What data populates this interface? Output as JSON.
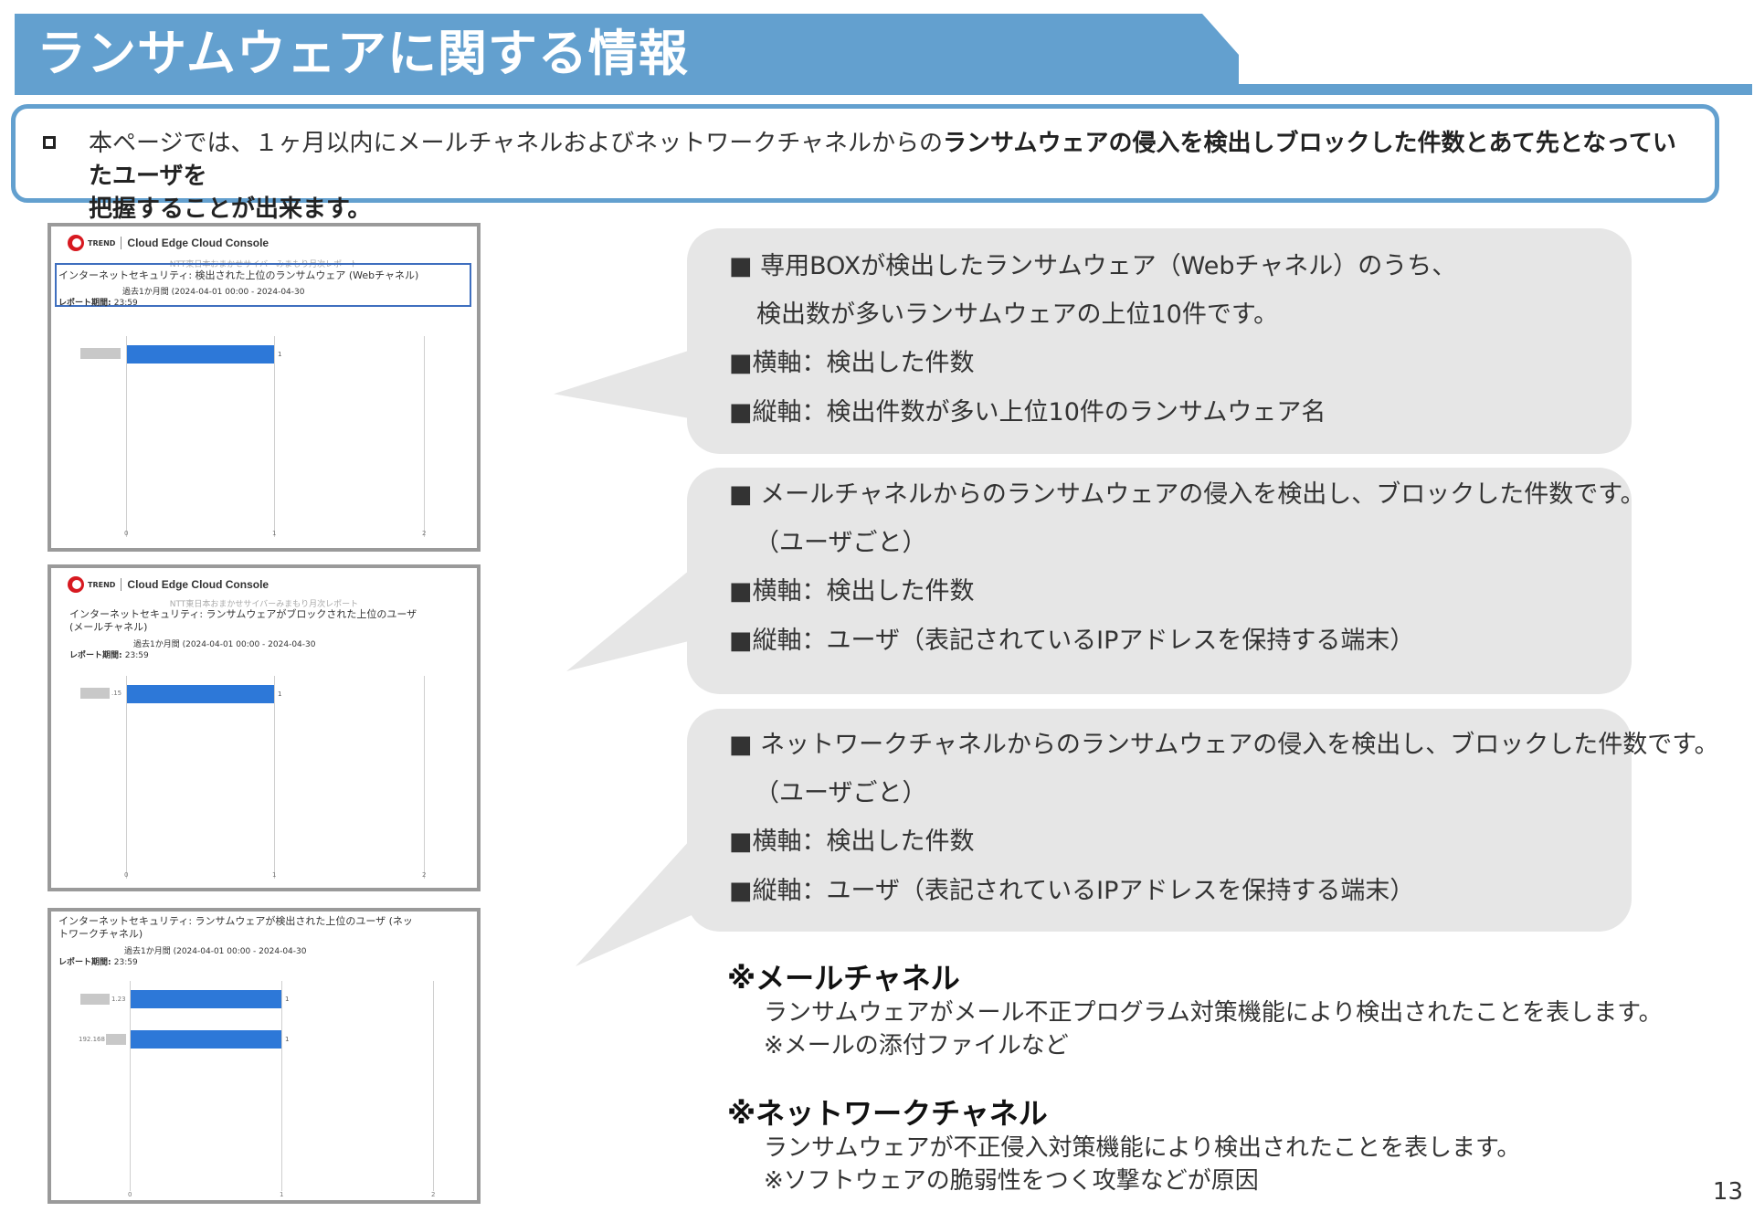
{
  "header": {
    "title": "ランサムウェアに関する情報"
  },
  "intro": {
    "text_normal": "本ページでは、１ヶ月以内にメールチャネルおよびネットワークチャネルからの",
    "text_bold_1": "ランサムウェアの侵入を検出しブロックした件数とあて先となっていたユーザを",
    "text_bold_2": "把握することが出来ます。"
  },
  "panels": [
    {
      "console": "Cloud Edge Cloud Console",
      "report": "NTT東日本おまかせサイバーみまもり月次レポート",
      "title": "インターネットセキュリティ: 検出された上位のランサムウェア (Webチャネル)",
      "period": "過去1か月間 (2024-04-01 00:00 - 2024-04-30",
      "period_label": "レポート期間:",
      "period_end": "23:59",
      "ticks": [
        "0",
        "1",
        "2"
      ],
      "bar_value_label": "1"
    },
    {
      "console": "Cloud Edge Cloud Console",
      "report": "NTT東日本おまかせサイバーみまもり月次レポート",
      "title_1": "インターネットセキュリティ: ランサムウェアがブロックされた上位のユーザ",
      "title_2": "(メールチャネル)",
      "period": "過去1か月間 (2024-04-01 00:00 - 2024-04-30",
      "period_label": "レポート期間:",
      "period_end": "23:59",
      "ticks": [
        "0",
        "1",
        "2"
      ],
      "bar_value_label": "1",
      "row_label": ".15"
    },
    {
      "title_1": "インターネットセキュリティ: ランサムウェアが検出された上位のユーザ (ネッ",
      "title_2": "トワークチャネル)",
      "period": "過去1か月間 (2024-04-01 00:00 - 2024-04-30",
      "period_label": "レポート期間:",
      "period_end": "23:59",
      "ticks": [
        "0",
        "1",
        "2"
      ],
      "bar_value_label_1": "1",
      "bar_value_label_2": "1",
      "row_label_1": "1.23",
      "row_label_2": "192.168"
    }
  ],
  "bubbles": [
    {
      "lines": [
        "■  専用BOXが検出したランサムウェア（Webチャネル）のうち、",
        "検出数が多いランサムウェアの上位10件です。",
        "■横軸：検出した件数",
        "■縦軸：検出件数が多い上位10件のランサムウェア名"
      ]
    },
    {
      "lines": [
        "■  メールチャネルからのランサムウェアの侵入を検出し、ブロックした件数です。",
        "（ユーザごと）",
        "■横軸：検出した件数",
        "■縦軸：ユーザ（表記されているIPアドレスを保持する端末）"
      ]
    },
    {
      "lines": [
        "■  ネットワークチャネルからのランサムウェアの侵入を検出し、ブロックした件数です。",
        "（ユーザごと）",
        "■横軸：検出した件数",
        "■縦軸：ユーザ（表記されているIPアドレスを保持する端末）"
      ]
    }
  ],
  "notes": [
    {
      "title": "※メールチャネル",
      "line1": "ランサムウェアがメール不正プログラム対策機能により検出されたことを表します。",
      "line2": "※メールの添付ファイルなど"
    },
    {
      "title": "※ネットワークチャネル",
      "line1": "ランサムウェアが不正侵入対策機能により検出されたことを表します。",
      "line2": "※ソフトウェアの脆弱性をつく攻撃などが原因"
    }
  ],
  "page_number": "13"
}
